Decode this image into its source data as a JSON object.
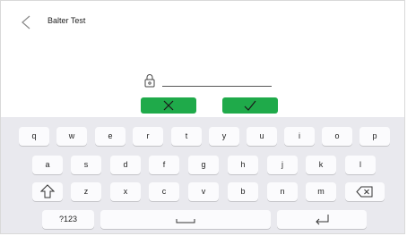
{
  "header": {
    "title": "Balter Test",
    "back_icon": "chevron-left-icon"
  },
  "pin": {
    "lock_icon": "padlock-icon",
    "value": ""
  },
  "buttons": {
    "cancel_icon": "x-icon",
    "confirm_icon": "checkmark-icon",
    "color": "#1faa4a"
  },
  "keyboard": {
    "row1": [
      "q",
      "w",
      "e",
      "r",
      "t",
      "y",
      "u",
      "i",
      "o",
      "p"
    ],
    "row2": [
      "a",
      "s",
      "d",
      "f",
      "g",
      "h",
      "j",
      "k",
      "l"
    ],
    "row3": [
      "z",
      "x",
      "c",
      "v",
      "b",
      "n",
      "m"
    ],
    "mode_key": "?123",
    "shift_icon": "shift-icon",
    "backspace_icon": "backspace-icon",
    "space_icon": "space-bar-icon",
    "enter_icon": "enter-icon"
  }
}
